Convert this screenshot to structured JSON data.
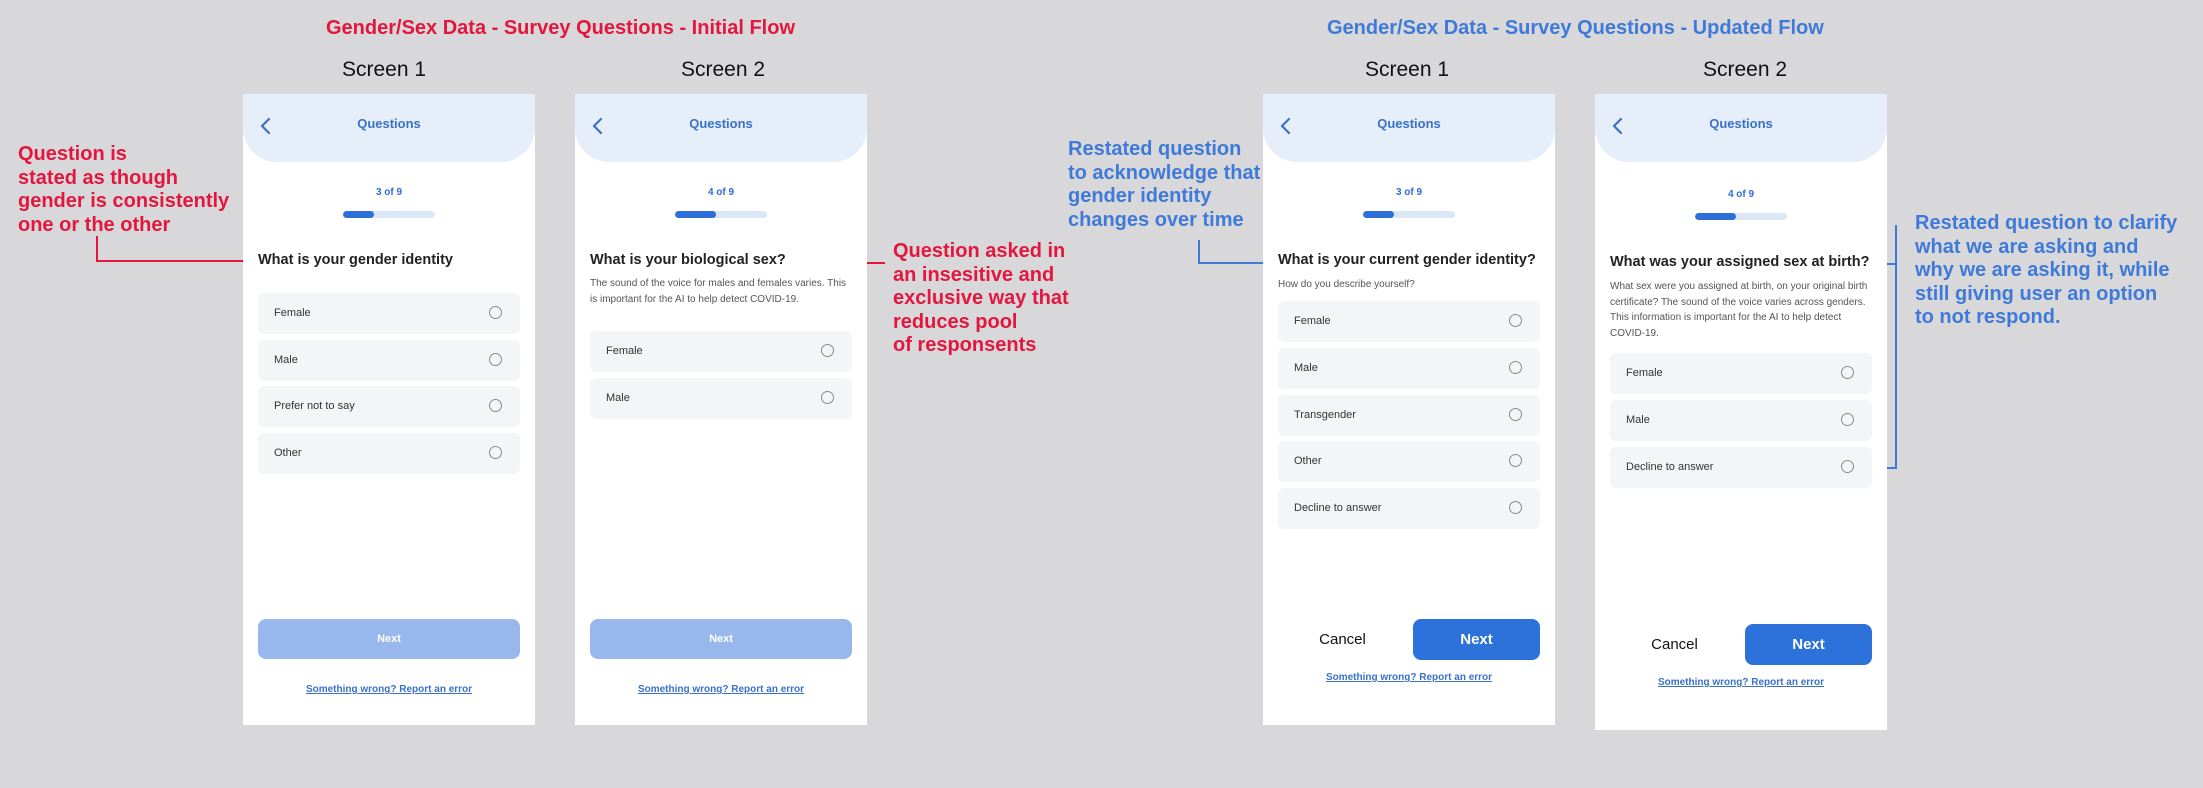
{
  "initial": {
    "title": "Gender/Sex Data - Survey Questions - Initial Flow",
    "screen1_label": "Screen 1",
    "screen2_label": "Screen 2",
    "annotation_left": [
      "Question is",
      "stated as though",
      "gender is consistently",
      "one or the other"
    ],
    "annotation_right": [
      "Question asked in",
      "an insesitive and",
      "exclusive way that",
      "reduces pool",
      "of responsents"
    ],
    "accent_color": "#e3173e"
  },
  "updated": {
    "title": "Gender/Sex Data - Survey Questions - Updated Flow",
    "screen1_label": "Screen 1",
    "screen2_label": "Screen 2",
    "annotation_left": [
      "Restated question",
      "to acknowledge that",
      "gender identity",
      "changes over time"
    ],
    "annotation_right": [
      "Restated question to clarify",
      "what we are asking and",
      "why we are asking it, while",
      "still giving user an option",
      "to not respond."
    ],
    "accent_color": "#3f7ad8"
  },
  "phones": {
    "p1": {
      "header": "Questions",
      "step": "3 of 9",
      "progress": 0.333,
      "question": "What is your gender identity",
      "options": [
        "Female",
        "Male",
        "Prefer not to say",
        "Other"
      ],
      "next": "Next",
      "report": "Something wrong? Report an error"
    },
    "p2": {
      "header": "Questions",
      "step": "4 of 9",
      "progress": 0.444,
      "question": "What is your biological sex?",
      "desc": "The sound of the voice for males and females varies. This is important for the AI to help detect COVID-19.",
      "options": [
        "Female",
        "Male"
      ],
      "next": "Next",
      "report": "Something wrong? Report an error"
    },
    "p3": {
      "header": "Questions",
      "step": "3 of 9",
      "progress": 0.333,
      "question": "What is your current gender identity?",
      "desc": "How do you describe yourself?",
      "options": [
        "Female",
        "Male",
        "Transgender",
        "Other",
        "Decline to answer"
      ],
      "cancel": "Cancel",
      "next": "Next",
      "report": "Something wrong? Report an error"
    },
    "p4": {
      "header": "Questions",
      "step": "4 of 9",
      "progress": 0.444,
      "question": "What was your assigned sex at birth?",
      "desc": "What sex were you assigned at birth, on your original birth certificate? The sound of the voice varies across genders. This information is important for the AI to help detect COVID-19.",
      "options": [
        "Female",
        "Male",
        "Decline to answer"
      ],
      "cancel": "Cancel",
      "next": "Next",
      "report": "Something wrong? Report an error"
    }
  }
}
